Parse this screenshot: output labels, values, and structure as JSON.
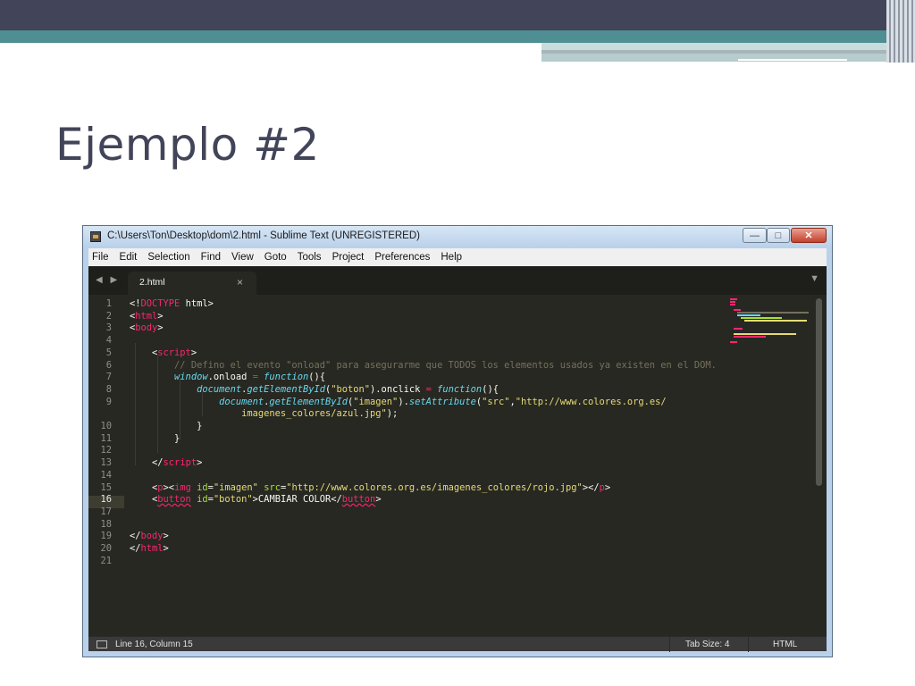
{
  "slide": {
    "title": "Ejemplo #2"
  },
  "window": {
    "title": "C:\\Users\\Ton\\Desktop\\dom\\2.html - Sublime Text (UNREGISTERED)",
    "buttons": {
      "minimize": "—",
      "maximize": "□",
      "close": "✕"
    }
  },
  "menu": [
    "File",
    "Edit",
    "Selection",
    "Find",
    "View",
    "Goto",
    "Tools",
    "Project",
    "Preferences",
    "Help"
  ],
  "tabs": {
    "active": "2.html",
    "close": "×",
    "nav": "◀ ▶",
    "dropdown": "▼"
  },
  "code": {
    "line_numbers": [
      "1",
      "2",
      "3",
      "4",
      "5",
      "6",
      "7",
      "8",
      "9",
      "",
      "10",
      "11",
      "12",
      "13",
      "14",
      "15",
      "16",
      "17",
      "18",
      "19",
      "20",
      "21"
    ],
    "active_line": "16"
  },
  "status": {
    "position": "Line 16, Column 15",
    "tab_size": "Tab Size: 4",
    "syntax": "HTML"
  },
  "colors": {
    "editor_bg": "#272822",
    "keyword": "#f92672",
    "string": "#e6db74",
    "attribute": "#a6e22e",
    "comment": "#75715e"
  }
}
